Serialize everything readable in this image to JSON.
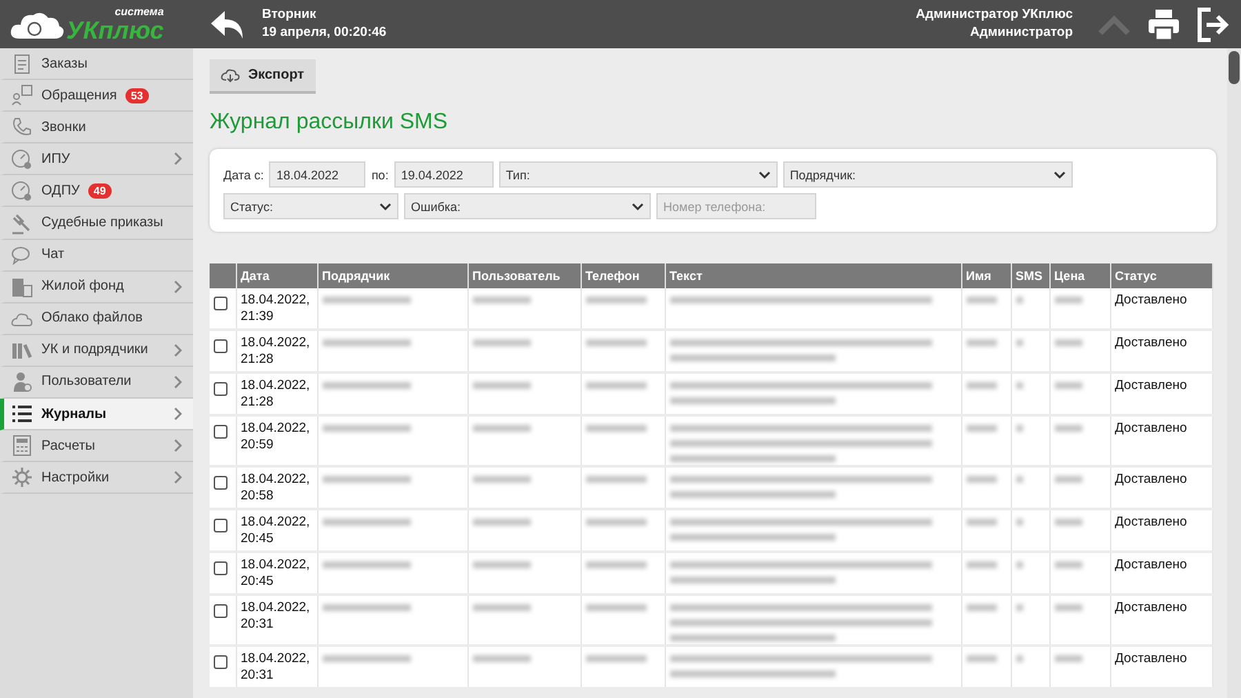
{
  "header": {
    "logo_small": "система",
    "logo_big": "УКплюс",
    "day": "Вторник",
    "datetime": "19 апреля, 00:20:46",
    "user_name": "Администратор УКплюс",
    "user_role": "Администратор"
  },
  "sidebar": {
    "items": [
      {
        "label": "Заказы",
        "has_submenu": false,
        "selected": false
      },
      {
        "label": "Обращения",
        "badge": "53",
        "has_submenu": false,
        "selected": false
      },
      {
        "label": "Звонки",
        "has_submenu": false,
        "selected": false
      },
      {
        "label": "ИПУ",
        "has_submenu": true,
        "selected": false
      },
      {
        "label": "ОДПУ",
        "badge": "49",
        "has_submenu": false,
        "selected": false
      },
      {
        "label": "Судебные приказы",
        "has_submenu": false,
        "selected": false
      },
      {
        "label": "Чат",
        "has_submenu": false,
        "selected": false
      },
      {
        "label": "Жилой фонд",
        "has_submenu": true,
        "selected": false
      },
      {
        "label": "Облако файлов",
        "has_submenu": false,
        "selected": false
      },
      {
        "label": "УК и подрядчики",
        "has_submenu": true,
        "selected": false
      },
      {
        "label": "Пользователи",
        "has_submenu": true,
        "selected": false
      },
      {
        "label": "Журналы",
        "has_submenu": true,
        "selected": true
      },
      {
        "label": "Расчеты",
        "has_submenu": true,
        "selected": false
      },
      {
        "label": "Настройки",
        "has_submenu": true,
        "selected": false
      }
    ]
  },
  "toolbar": {
    "export_button": "Экспорт"
  },
  "title": "Журнал рассылки SMS",
  "filters": {
    "date_from_label": "Дата с:",
    "date_from": "18.04.2022",
    "date_to_label": "по:",
    "date_to": "19.04.2022",
    "type": "Тип:",
    "contractor": "Подрядчик:",
    "status": "Статус:",
    "error": "Ошибка:",
    "phone_placeholder": "Номер телефона:"
  },
  "table": {
    "columns": [
      "Дата",
      "Подрядчик",
      "Пользователь",
      "Телефон",
      "Текст",
      "Имя",
      "SMS",
      "Цена",
      "Статус"
    ],
    "rows": [
      {
        "date": "18.04.2022, 21:39",
        "status": "Доставлено",
        "checked": false,
        "kind": "one_line"
      },
      {
        "date": "18.04.2022, 21:28",
        "status": "Доставлено",
        "checked": false,
        "kind": "two_line"
      },
      {
        "date": "18.04.2022, 21:28",
        "status": "Доставлено",
        "checked": false,
        "kind": "two_line"
      },
      {
        "date": "18.04.2022, 20:59",
        "status": "Доставлено",
        "checked": false,
        "kind": "three_line"
      },
      {
        "date": "18.04.2022, 20:58",
        "status": "Доставлено",
        "checked": false,
        "kind": "two_line"
      },
      {
        "date": "18.04.2022, 20:45",
        "status": "Доставлено",
        "checked": false,
        "kind": "two_line"
      },
      {
        "date": "18.04.2022, 20:45",
        "status": "Доставлено",
        "checked": false,
        "kind": "two_line"
      },
      {
        "date": "18.04.2022, 20:31",
        "status": "Доставлено",
        "checked": false,
        "kind": "three_line"
      },
      {
        "date": "18.04.2022, 20:31",
        "status": "Доставлено",
        "checked": false,
        "kind": "two_line"
      }
    ]
  }
}
